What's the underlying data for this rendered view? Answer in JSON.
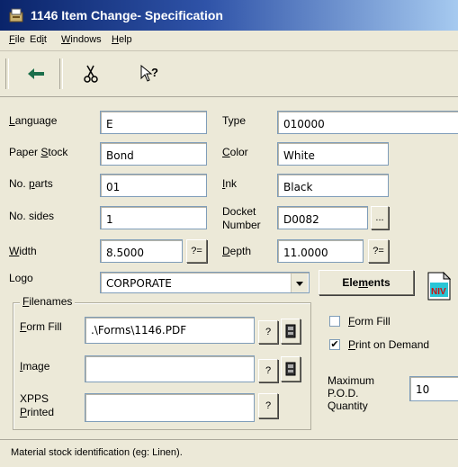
{
  "window": {
    "title": "1146 Item Change- Specification"
  },
  "menu": {
    "file": {
      "accel": "F",
      "rest": "ile"
    },
    "edit": {
      "pre": "Ed",
      "accel": "i",
      "rest": "t"
    },
    "windows": {
      "accel": "W",
      "rest": "indows"
    },
    "help": {
      "accel": "H",
      "rest": "elp"
    }
  },
  "toolbar": {
    "icons": [
      "back-arrow-icon",
      "scissors-icon",
      "whats-this-help-icon"
    ]
  },
  "form": {
    "language": {
      "label_accel": "L",
      "label_rest": "anguage",
      "value": "E"
    },
    "type": {
      "label": "Type",
      "value": "010000"
    },
    "paper_stock": {
      "label_pre": "Paper ",
      "label_accel": "S",
      "label_rest": "tock",
      "value": "Bond"
    },
    "color": {
      "label_accel": "C",
      "label_rest": "olor",
      "value": "White"
    },
    "no_parts": {
      "label_pre": "No. ",
      "label_accel": "p",
      "label_rest": "arts",
      "value": "01"
    },
    "ink": {
      "label_accel": "I",
      "label_rest": "nk",
      "value": "Black"
    },
    "no_sides": {
      "label": "No. sides",
      "value": "1"
    },
    "docket_number": {
      "label_line1": "Docket",
      "label_line2": "Number",
      "value": "D0082",
      "browse_label": "..."
    },
    "width": {
      "label_accel": "W",
      "label_rest": "idth",
      "value": "8.5000",
      "btn_label": "?="
    },
    "depth": {
      "label_accel": "D",
      "label_rest": "epth",
      "value": "11.0000",
      "btn_label": "?="
    },
    "logo": {
      "label": "Logo",
      "value": "CORPORATE"
    },
    "elements_button": {
      "pre": "Ele",
      "accel": "m",
      "rest": "ents"
    }
  },
  "filenames": {
    "group_title_accel": "F",
    "group_title_rest": "ilenames",
    "form_fill": {
      "label_accel": "F",
      "label_rest": "orm Fill",
      "value": ".\\Forms\\1146.PDF",
      "help_label": "?"
    },
    "image": {
      "label_accel": "I",
      "label_rest": "mage",
      "value": "",
      "help_label": "?"
    },
    "xpps_printed": {
      "label_line1": "XPPS",
      "label_line2_accel": "P",
      "label_line2_rest": "rinted",
      "value": "",
      "help_label": "?"
    }
  },
  "options": {
    "form_fill_checkbox": {
      "accel": "F",
      "rest": "orm Fill",
      "checked": false
    },
    "print_on_demand_checkbox": {
      "accel": "P",
      "rest": "rint on Demand",
      "checked": true,
      "mark": "✔"
    },
    "max_pod_quantity": {
      "label_line1": "Maximum",
      "label_line2": "P.O.D.",
      "label_line3": "Quantity",
      "value": "10"
    }
  },
  "status": {
    "text": "Material stock identification (eg: Linen)."
  },
  "colors": {
    "title_start": "#0a246a",
    "title_end": "#a6caf0",
    "face": "#ece9d8",
    "niv_fill": "#29c5d6",
    "niv_text": "#d01010"
  }
}
